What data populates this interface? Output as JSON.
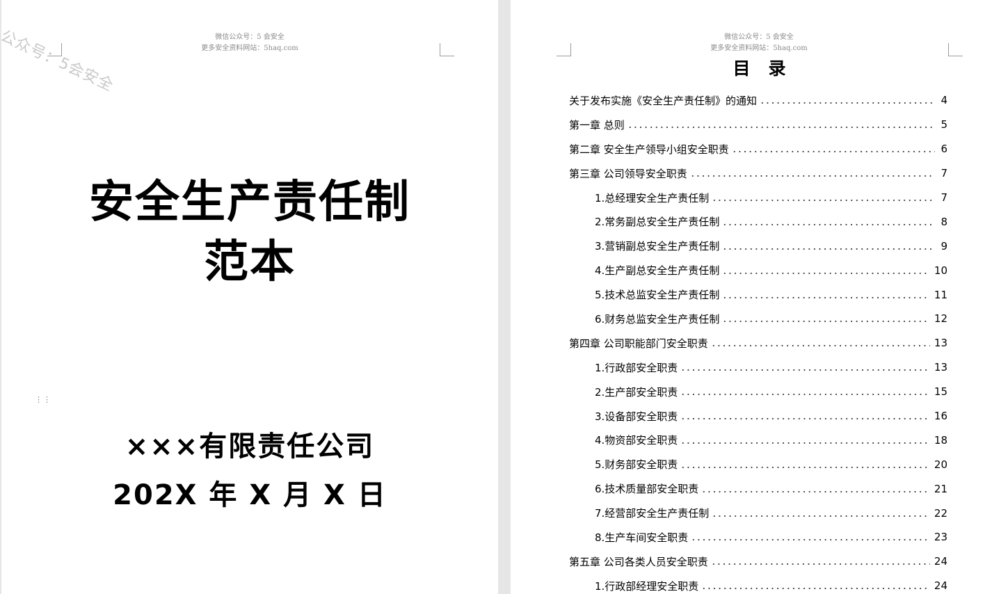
{
  "header": {
    "line1": "微信公众号：5 会安全",
    "line2": "更多安全资料网站：5haq.com"
  },
  "watermark": "公众号：5会安全",
  "cover": {
    "title_line1": "安全生产责任制",
    "title_line2": "范本",
    "company": "×××有限责任公司",
    "date": "202X 年 X 月 X 日"
  },
  "toc": {
    "heading": "目录",
    "entries": [
      {
        "text": "关于发布实施《安全生产责任制》的通知",
        "page": "4",
        "level": 1
      },
      {
        "text": "第一章  总则",
        "page": "5",
        "level": 1
      },
      {
        "text": "第二章  安全生产领导小组安全职责",
        "page": "6",
        "level": 1
      },
      {
        "text": "第三章  公司领导安全职责",
        "page": "7",
        "level": 1
      },
      {
        "text": "1.总经理安全生产责任制",
        "page": "7",
        "level": 2
      },
      {
        "text": "2.常务副总安全生产责任制",
        "page": "8",
        "level": 2
      },
      {
        "text": "3.营销副总安全生产责任制",
        "page": "9",
        "level": 2
      },
      {
        "text": "4.生产副总安全生产责任制",
        "page": "10",
        "level": 2
      },
      {
        "text": "5.技术总监安全生产责任制",
        "page": "11",
        "level": 2
      },
      {
        "text": "6.财务总监安全生产责任制",
        "page": "12",
        "level": 2
      },
      {
        "text": "第四章   公司职能部门安全职责",
        "page": "13",
        "level": 1
      },
      {
        "text": "1.行政部安全职责",
        "page": "13",
        "level": 2
      },
      {
        "text": "2.生产部安全职责",
        "page": "15",
        "level": 2
      },
      {
        "text": "3.设备部安全职责",
        "page": "16",
        "level": 2
      },
      {
        "text": "4.物资部安全职责",
        "page": "18",
        "level": 2
      },
      {
        "text": "5.财务部安全职责",
        "page": "20",
        "level": 2
      },
      {
        "text": "6.技术质量部安全职责",
        "page": "21",
        "level": 2
      },
      {
        "text": "7.经营部安全生产责任制",
        "page": "22",
        "level": 2
      },
      {
        "text": "8.生产车间安全职责",
        "page": "23",
        "level": 2
      },
      {
        "text": "第五章   公司各类人员安全职责",
        "page": "24",
        "level": 1
      },
      {
        "text": "1.行政部经理安全职责",
        "page": "24",
        "level": 2
      }
    ]
  }
}
